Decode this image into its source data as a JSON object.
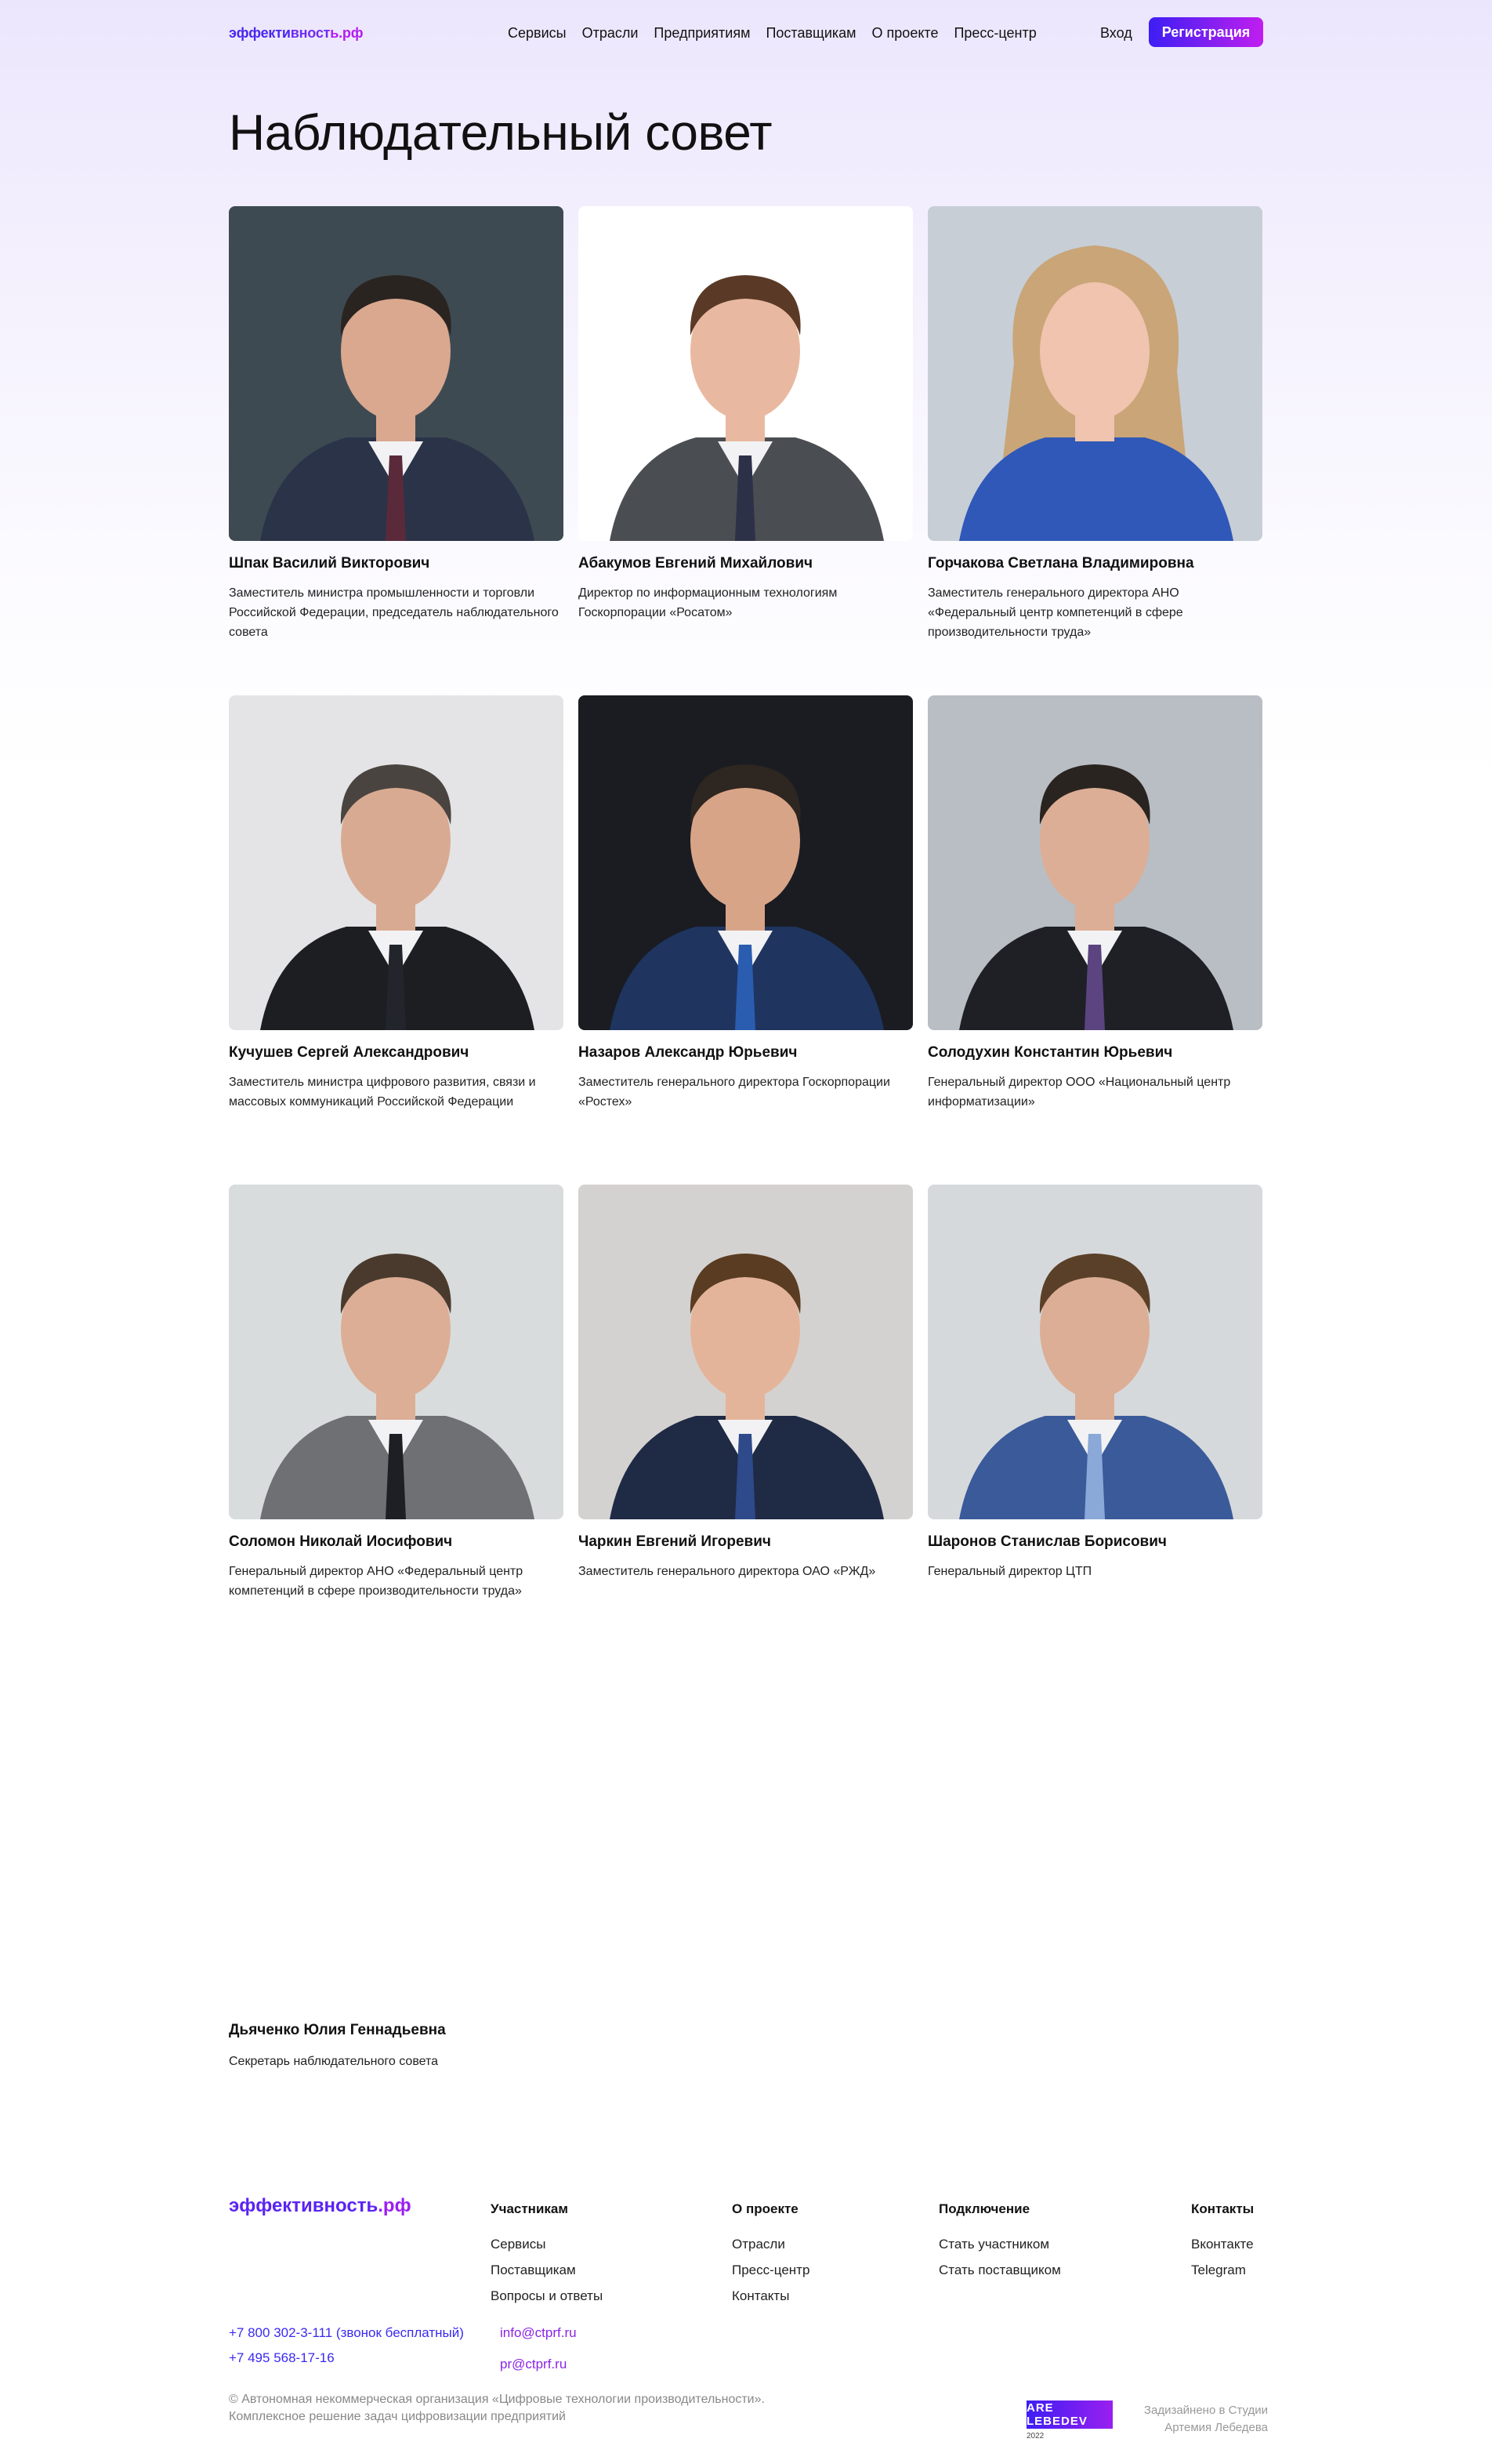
{
  "header": {
    "logo_pre": "эффекти",
    "logo_mid": "вност",
    "logo_post": "ь.рф",
    "nav": [
      "Сервисы",
      "Отрасли",
      "Предприятиям",
      "Поставщикам",
      "О проекте",
      "Пресс-центр"
    ],
    "login": "Вход",
    "register": "Регистрация"
  },
  "page": {
    "title": "Наблюдательный совет"
  },
  "members": [
    {
      "name": "Шпак Василий Викторович",
      "role": "Заместитель министра промышленности и торговли Российской Федерации, председатель наблюдательного совета",
      "bg": "#3e4a52",
      "suit": "#2b3348",
      "hair": "#2a2421",
      "skin": "#d9a88f",
      "tie": "#5a2a3a"
    },
    {
      "name": "Абакумов Евгений Михайлович",
      "role": "Директор по информационным технологиям Госкорпорации «Росатом»",
      "bg": "#ffffff",
      "suit": "#4a4d52",
      "hair": "#5a3a26",
      "skin": "#e8b9a0",
      "tie": "#2d3148"
    },
    {
      "name": "Горчакова Светлана Владимировна",
      "role": "Заместитель генерального директора АНО «Федеральный центр компетенций в сфере производительности труда»",
      "bg": "#c7ced6",
      "suit": "#2f58b8",
      "hair": "#c9a578",
      "skin": "#f0c4ae",
      "tie": "#2f58b8"
    },
    {
      "name": "Кучушев Сергей Александрович",
      "role": "Заместитель министра цифрового развития, связи и массовых коммуникаций Российской Федерации",
      "bg": "#e4e4e6",
      "suit": "#1c1e22",
      "hair": "#4a4440",
      "skin": "#d9aa92",
      "tie": "#22252b"
    },
    {
      "name": "Назаров Александр Юрьевич",
      "role": "Заместитель генерального директора Госкорпорации «Ростех»",
      "bg": "#1a1c22",
      "suit": "#1f3560",
      "hair": "#2e2620",
      "skin": "#d8a488",
      "tie": "#2a5db0"
    },
    {
      "name": "Солодухин Константин Юрьевич",
      "role": "Генеральный директор ООО «Национальный центр информатизации»",
      "bg": "#b9bec4",
      "suit": "#1e2025",
      "hair": "#2a2420",
      "skin": "#dcae96",
      "tie": "#5b4480"
    },
    {
      "name": "Соломон Николай Иосифович",
      "role": "Генеральный директор АНО «Федеральный центр компетенций в сфере производительности труда»",
      "bg": "#d9dcdc",
      "suit": "#6e7074",
      "hair": "#4a3a2e",
      "skin": "#dcae96",
      "tie": "#1d1f24"
    },
    {
      "name": "Чаркин Евгений Игоревич",
      "role": "Заместитель генерального директора ОАО «РЖД»",
      "bg": "#d4d2d0",
      "suit": "#1f2a45",
      "hair": "#5a3c22",
      "skin": "#e4b49a",
      "tie": "#2e4a8a"
    },
    {
      "name": "Шаронов Станислав Борисович",
      "role": "Генеральный директор ЦТП",
      "bg": "#d6d9dc",
      "suit": "#3a5a9a",
      "hair": "#5a4028",
      "skin": "#dcae96",
      "tie": "#8aa8d8"
    }
  ],
  "secretary": {
    "name": "Дьяченко Юлия Геннадьевна",
    "role": "Секретарь наблюдательного совета"
  },
  "footer": {
    "logo_main": "эффективность",
    "logo_post": ".рф",
    "columns": [
      {
        "title": "Участникам",
        "links": [
          "Сервисы",
          "Поставщикам",
          "Вопросы и ответы"
        ]
      },
      {
        "title": "О проекте",
        "links": [
          "Отрасли",
          "Пресс-центр",
          "Контакты"
        ]
      },
      {
        "title": "Подключение",
        "links": [
          "Стать участником",
          "Стать поставщиком"
        ]
      },
      {
        "title": "Контакты",
        "links": [
          "Вконтакте",
          "Telegram"
        ]
      }
    ],
    "phone1": "+7 800 302-3-111",
    "phone1_note": "(звонок бесплатный)",
    "phone2": "+7 495 568-17-16",
    "email1": "info@ctprf.ru",
    "email2": "pr@ctprf.ru",
    "copyright_line1": "© Автономная некоммерческая организация «Цифровые технологии производительности».",
    "copyright_line2": "Комплексное решение задач цифровизации предприятий",
    "studio_logo": "ARE LEBEDEV",
    "studio_year": "2022",
    "studio_line1": "Задизайнено в Студии",
    "studio_line2": "Артемия Лебедева"
  }
}
